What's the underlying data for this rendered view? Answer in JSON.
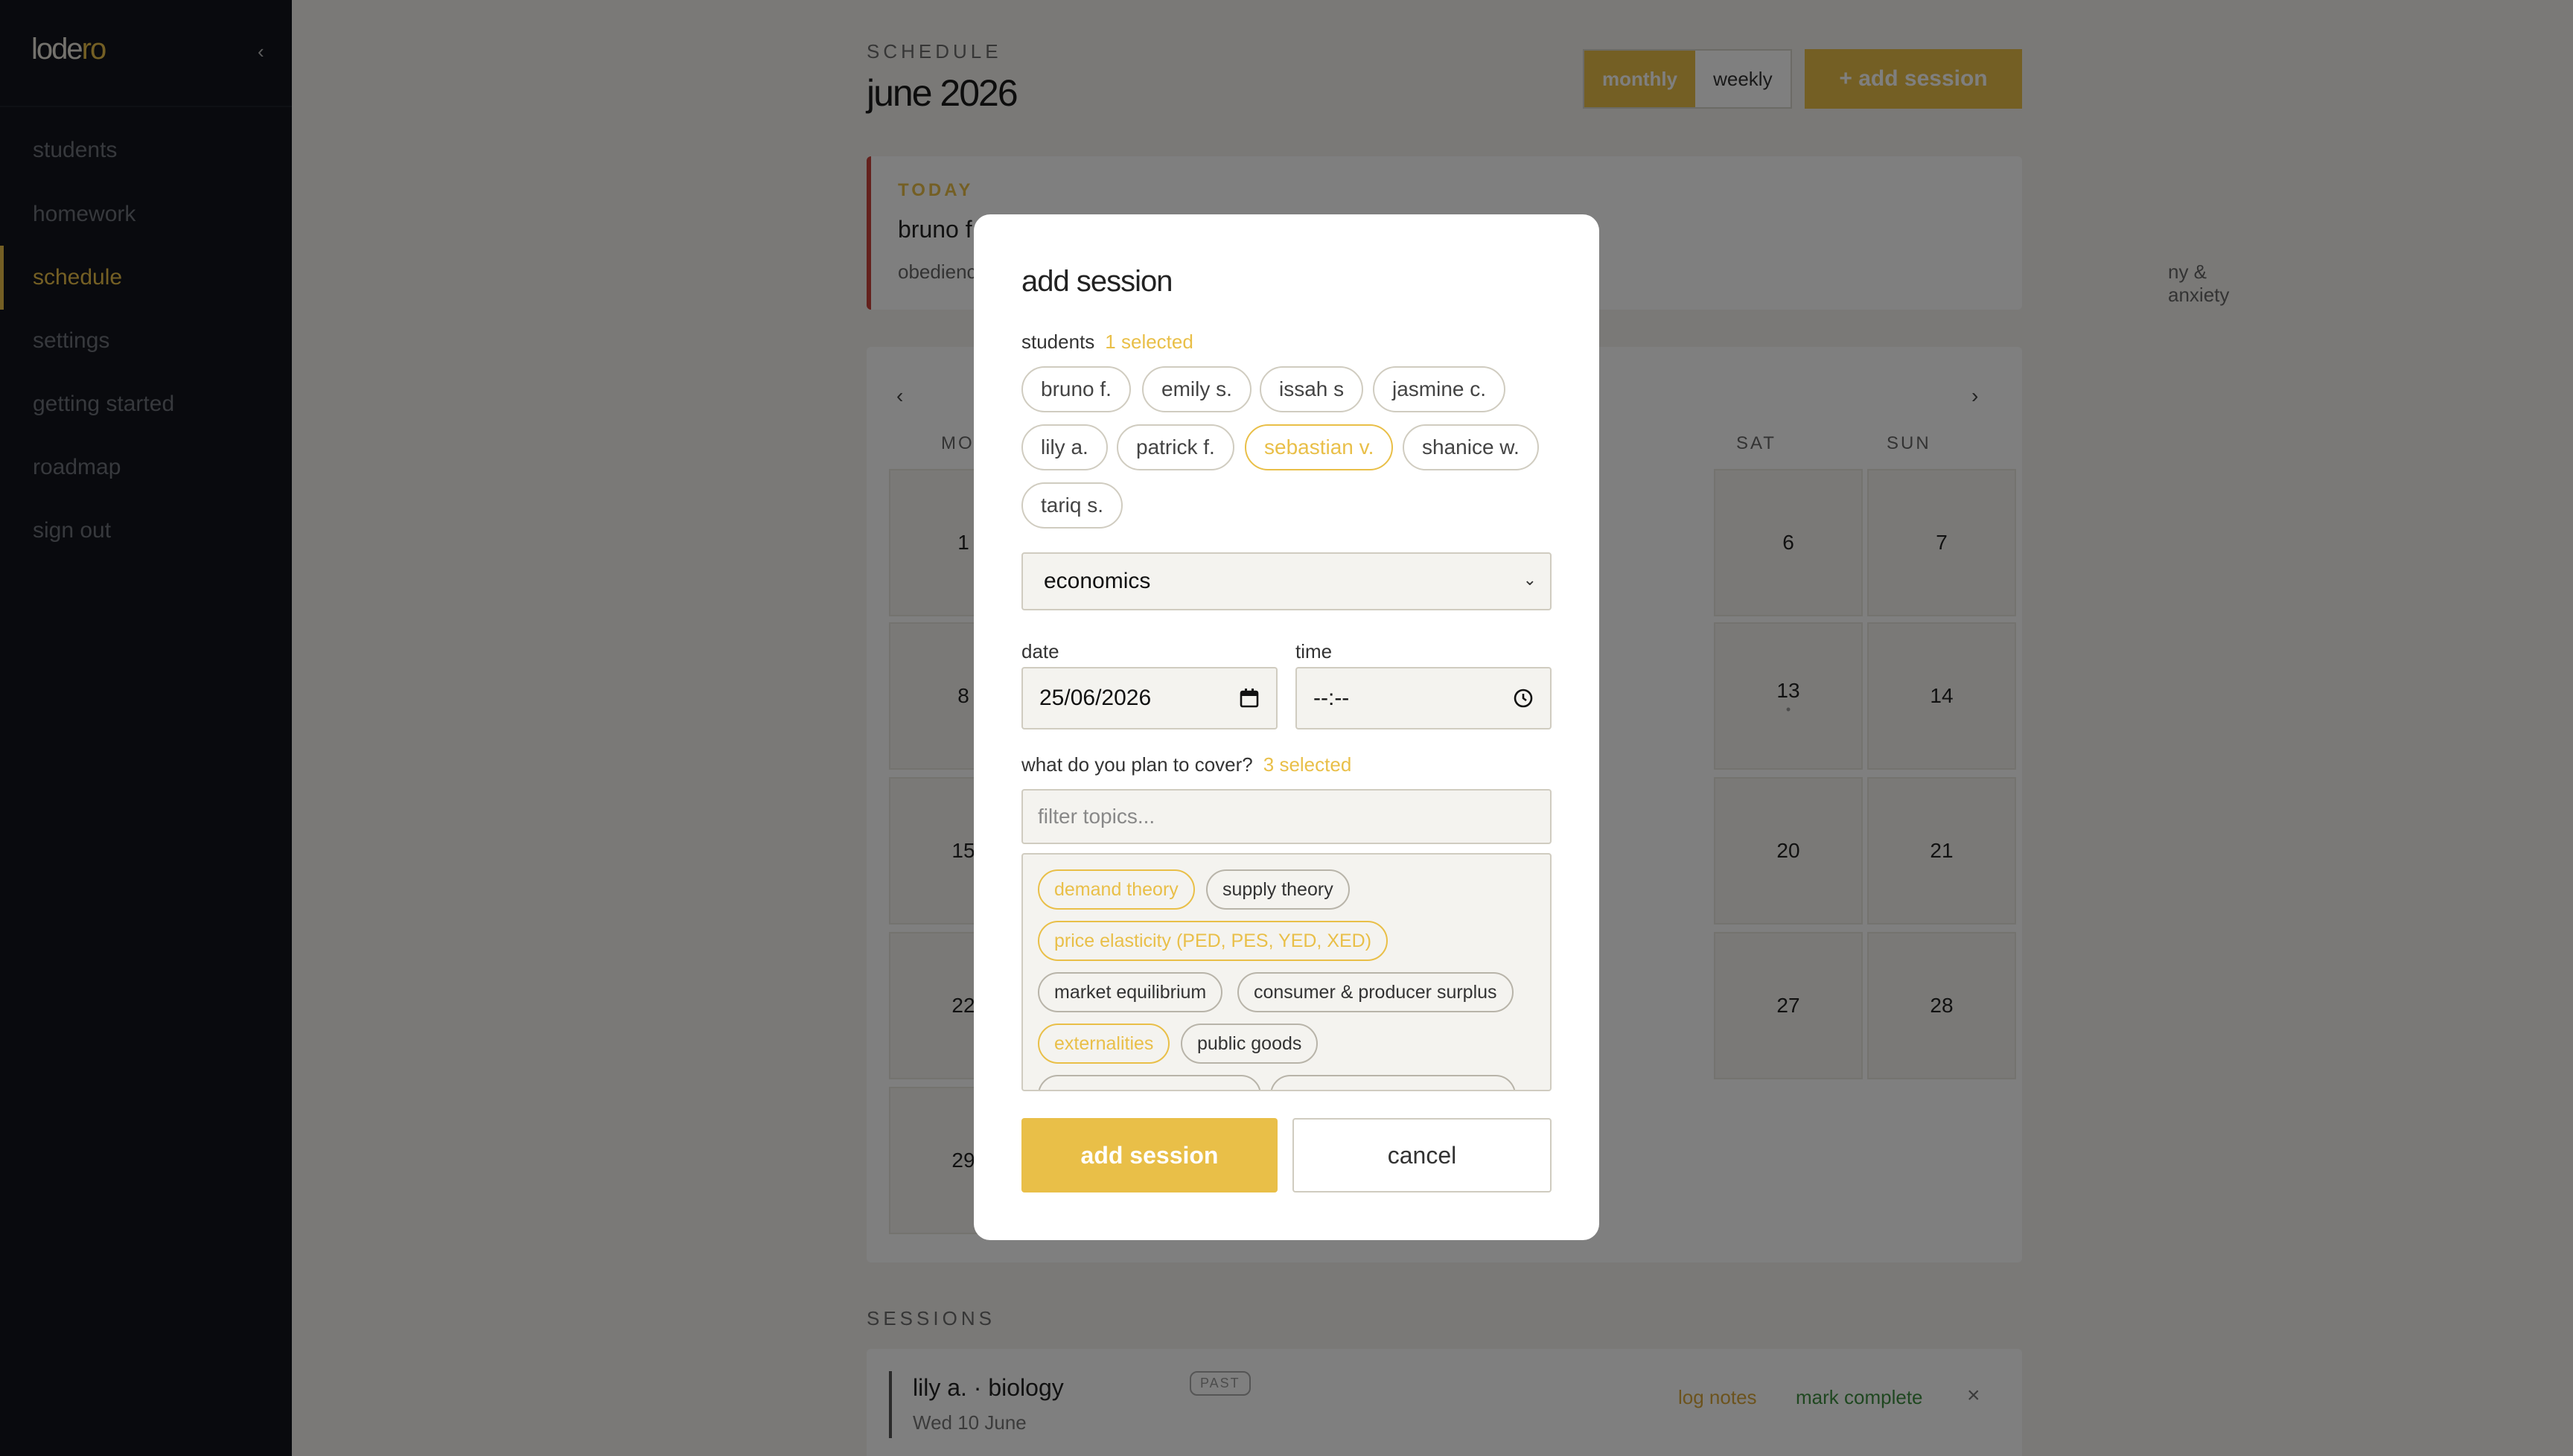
{
  "sidebar": {
    "logo_main": "lode",
    "logo_accent": "ro",
    "collapse_glyph": "‹",
    "items": [
      {
        "label": "students"
      },
      {
        "label": "homework"
      },
      {
        "label": "schedule",
        "active": true
      },
      {
        "label": "settings"
      },
      {
        "label": "getting started"
      },
      {
        "label": "roadmap"
      },
      {
        "label": "sign out"
      }
    ]
  },
  "header": {
    "eyebrow": "SCHEDULE",
    "title": "june 2026",
    "view_toggle": {
      "monthly": "monthly",
      "weekly": "weekly",
      "active": "monthly"
    },
    "add_label": "+ add session"
  },
  "today": {
    "label": "TODAY",
    "name": "bruno f.",
    "subtitle_left": "obedienc",
    "subtitle_right": "ny & anxiety"
  },
  "calendar": {
    "prev": "‹",
    "next": "›",
    "dow": {
      "mon": "MO",
      "sat": "SAT",
      "sun": "SUN"
    },
    "partial_days": [
      "1",
      "8",
      "15",
      "22",
      "29"
    ],
    "weekend_days": [
      [
        "6",
        "7"
      ],
      [
        "13",
        "14"
      ],
      [
        "20",
        "21"
      ],
      [
        "27",
        "28"
      ]
    ]
  },
  "sessions": {
    "title": "SESSIONS",
    "items": [
      {
        "name": "lily a. · biology",
        "badge": "PAST",
        "date": "Wed 10 June",
        "log": "log notes",
        "complete": "mark complete",
        "remove": "×"
      }
    ]
  },
  "modal": {
    "title": "add session",
    "students_label": "students",
    "students_count": "1 selected",
    "students": [
      {
        "name": "bruno f.",
        "selected": false
      },
      {
        "name": "emily s.",
        "selected": false
      },
      {
        "name": "issah s",
        "selected": false
      },
      {
        "name": "jasmine c.",
        "selected": false
      },
      {
        "name": "lily a.",
        "selected": false
      },
      {
        "name": "patrick f.",
        "selected": false
      },
      {
        "name": "sebastian v.",
        "selected": true
      },
      {
        "name": "shanice w.",
        "selected": false
      },
      {
        "name": "tariq s.",
        "selected": false
      }
    ],
    "subject": "economics",
    "date_label": "date",
    "date_value": "25/06/2026",
    "time_label": "time",
    "time_value": "--:--",
    "topics_label": "what do you plan to cover?",
    "topics_count": "3 selected",
    "filter_placeholder": "filter topics...",
    "topics": [
      {
        "name": "demand theory",
        "selected": true
      },
      {
        "name": "supply theory",
        "selected": false
      },
      {
        "name": "price elasticity (PED, PES, YED, XED)",
        "selected": true
      },
      {
        "name": "market equilibrium",
        "selected": false
      },
      {
        "name": "consumer & producer surplus",
        "selected": false
      },
      {
        "name": "externalities",
        "selected": true
      },
      {
        "name": "public goods",
        "selected": false
      }
    ],
    "submit_label": "add session",
    "cancel_label": "cancel"
  },
  "colors": {
    "accent": "#e9bf48",
    "sidebar": "#12151c",
    "today_border": "#c8433a",
    "complete": "#3e8e41"
  },
  "icons": [
    "chevron-left-icon",
    "chevron-down-icon",
    "calendar-icon",
    "clock-icon",
    "close-icon"
  ]
}
